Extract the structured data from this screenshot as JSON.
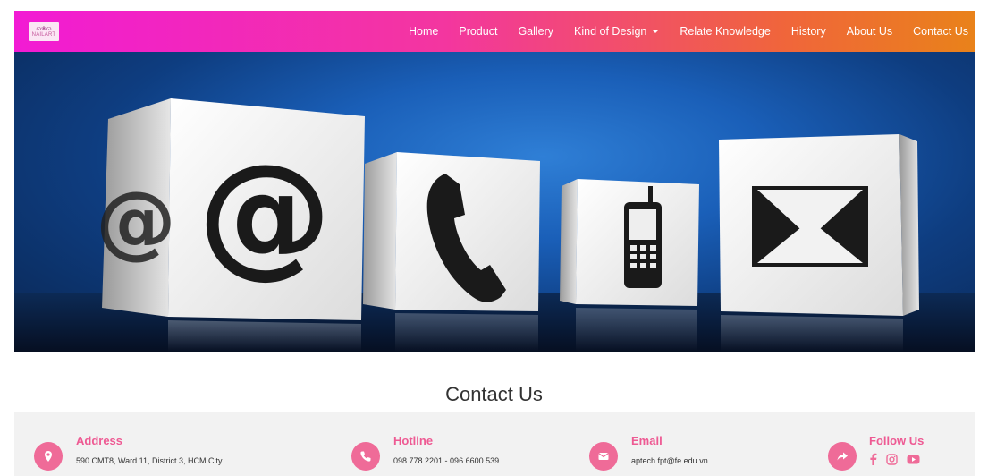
{
  "brand": {
    "logo_text": "NAILART",
    "logo_mark": "ɷ❀ɷ"
  },
  "nav": {
    "items": [
      {
        "label": "Home"
      },
      {
        "label": "Product"
      },
      {
        "label": "Gallery"
      },
      {
        "label": "Kind of Design",
        "dropdown": true
      },
      {
        "label": "Relate Knowledge"
      },
      {
        "label": "History"
      },
      {
        "label": "About Us"
      },
      {
        "label": "Contact Us"
      }
    ]
  },
  "hero": {
    "image": "contact-cubes",
    "icons": [
      "at-sign-icon",
      "phone-handset-icon",
      "mobile-phone-icon",
      "envelope-icon"
    ]
  },
  "page_title": "Contact Us",
  "contact": {
    "address": {
      "title": "Address",
      "text": "590 CMT8, Ward 11, District 3, HCM City",
      "icon": "location-pin-icon"
    },
    "hotline": {
      "title": "Hotline",
      "text": "098.778.2201 - 096.6600.539",
      "icon": "phone-icon"
    },
    "email": {
      "title": "Email",
      "text": "aptech.fpt@fe.edu.vn",
      "icon": "envelope-icon"
    },
    "follow": {
      "title": "Follow Us",
      "icon": "share-icon",
      "socials": [
        "facebook-icon",
        "instagram-icon",
        "youtube-icon"
      ]
    }
  },
  "colors": {
    "accent": "#ef6b98",
    "nav_gradient_start": "#f21bd4",
    "nav_gradient_end": "#e9821a"
  }
}
